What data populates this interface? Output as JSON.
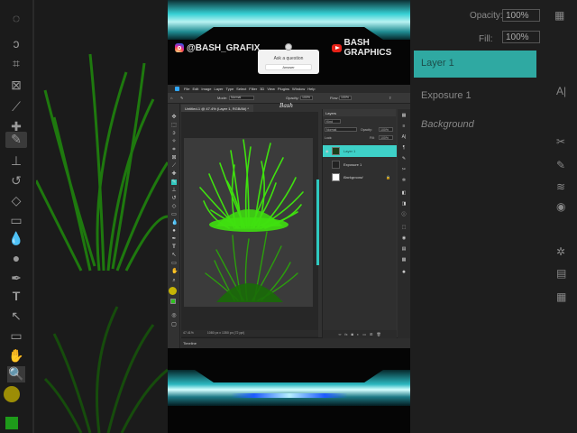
{
  "overlay": {
    "instagram_handle": "@BASH_GRAFIX",
    "youtube_channel": "BASH GRAPHICS",
    "question_box": {
      "title": "Ask a question",
      "button": "Answer"
    }
  },
  "photoshop": {
    "menu": [
      "File",
      "Edit",
      "Image",
      "Layer",
      "Type",
      "Select",
      "Filter",
      "3D",
      "View",
      "Plugins",
      "Window",
      "Help"
    ],
    "options_bar": {
      "mode_label": "Mode:",
      "mode_value": "Normal",
      "opacity_label": "Opacity:",
      "opacity_value": "100%",
      "flow_label": "Flow:",
      "flow_value": "100%"
    },
    "document_tab": "Untitled-1 @ 47.4% (Layer 1, RGB/8#) *",
    "status_bar": {
      "zoom": "47.41%",
      "size": "1080 px x 1350 px (72 ppi)"
    },
    "timeline_label": "Timeline",
    "layers_panel": {
      "title": "Layers",
      "filter_label": "Kind",
      "blend_mode": "Normal",
      "opacity_label": "Opacity:",
      "opacity_value": "100%",
      "lock_label": "Lock:",
      "fill_label": "Fill:",
      "fill_value": "100%",
      "layers": [
        {
          "name": "Layer 1",
          "selected": true
        },
        {
          "name": "Exposure 1",
          "selected": false
        },
        {
          "name": "Background",
          "selected": false
        }
      ]
    }
  },
  "background_blur": {
    "opacity_label": "Opacity:",
    "opacity_value": "100%",
    "fill_label": "Fill:",
    "fill_value": "100%",
    "layers": [
      "Layer 1",
      "Exposure 1",
      "Background"
    ]
  },
  "colors": {
    "accent_teal": "#3ed1c8",
    "grass_bright": "#3fe00f",
    "grass_dark": "#1f8a0c",
    "ps_blue": "#31a8ff"
  }
}
